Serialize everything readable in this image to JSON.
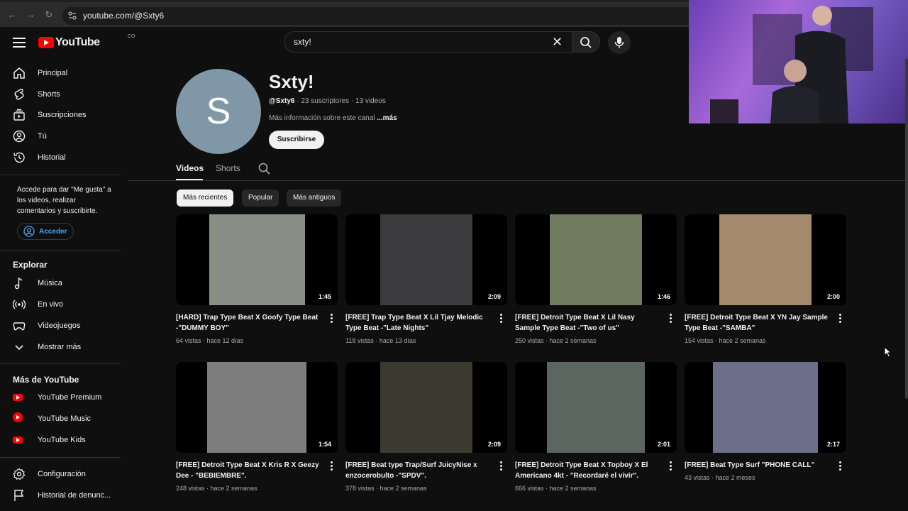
{
  "browser": {
    "url": "youtube.com/@Sxty6"
  },
  "masthead": {
    "logo_text": "YouTube",
    "logo_sup": "CO",
    "search_value": "sxty!"
  },
  "sidebar": {
    "items": [
      {
        "label": "Principal",
        "icon": "home-icon"
      },
      {
        "label": "Shorts",
        "icon": "shorts-icon"
      },
      {
        "label": "Suscripciones",
        "icon": "subscriptions-icon"
      },
      {
        "label": "Tú",
        "icon": "user-icon"
      },
      {
        "label": "Historial",
        "icon": "history-icon"
      }
    ],
    "signin_note": "Accede para dar \"Me gusta\" a los videos, realizar comentarios y suscribirte.",
    "signin_label": "Acceder",
    "explore_heading": "Explorar",
    "explore": [
      {
        "label": "Música",
        "icon": "music-icon"
      },
      {
        "label": "En vivo",
        "icon": "live-icon"
      },
      {
        "label": "Videojuegos",
        "icon": "gaming-icon"
      },
      {
        "label": "Mostrar más",
        "icon": "chevron-down-icon"
      }
    ],
    "more_heading": "Más de YouTube",
    "more": [
      {
        "label": "YouTube Premium",
        "icon": "youtube-premium-icon"
      },
      {
        "label": "YouTube Music",
        "icon": "youtube-music-icon"
      },
      {
        "label": "YouTube Kids",
        "icon": "youtube-kids-icon"
      }
    ],
    "settings": [
      {
        "label": "Configuración",
        "icon": "gear-icon"
      },
      {
        "label": "Historial de denunc...",
        "icon": "flag-icon"
      }
    ]
  },
  "channel": {
    "avatar_letter": "S",
    "name": "Sxty!",
    "handle": "@Sxty6",
    "stats": " · 23 suscriptores · 13 videos",
    "about": "Más información sobre este canal ",
    "about_more": "...más",
    "subscribe_label": "Suscribirse"
  },
  "tabs": {
    "videos": "Videos",
    "shorts": "Shorts"
  },
  "chips": {
    "recent": "Más recientes",
    "popular": "Popular",
    "oldest": "Más antiguos"
  },
  "videos": [
    {
      "title": "[HARD] Trap Type Beat X Goofy Type Beat -\"DUMMY BOY\"",
      "meta": "64 vistas · hace 12 días",
      "duration": "1:45",
      "thumb_color": "#8a8f86"
    },
    {
      "title": "[FREE] Trap Type Beat X Lil Tjay Melodic Type Beat -\"Late Nights\"",
      "meta": "118 vistas · hace 13 días",
      "duration": "2:09",
      "thumb_color": "#3b3b3e"
    },
    {
      "title": "[FREE] Detroit Type Beat X Lil Nasy Sample Type Beat -\"Two of us\"",
      "meta": "250 vistas · hace 2 semanas",
      "duration": "1:46",
      "thumb_color": "#6f7a5e"
    },
    {
      "title": "[FREE] Detroit Type Beat X YN Jay Sample Type Beat -\"SAMBA\"",
      "meta": "154 vistas · hace 2 semanas",
      "duration": "2:00",
      "thumb_color": "#a68a6e"
    },
    {
      "title": "[FREE] Detroit Type Beat X Kris R X Geezy Dee - \"BEBIEMBRE\".",
      "meta": "248 vistas · hace 2 semanas",
      "duration": "1:54",
      "thumb_color": "#7d7d7d"
    },
    {
      "title": "[FREE] Beat type Trap/Surf JuicyNise x enzocerobulto -\"SPDV\".",
      "meta": "378 vistas · hace 2 semanas",
      "duration": "2:09",
      "thumb_color": "#3c3a2e"
    },
    {
      "title": "[FREE] Detroit Type Beat X Topboy X El Americano 4kt - \"Recordaré el vivir\".",
      "meta": "666 vistas · hace 2 semanas",
      "duration": "2:01",
      "thumb_color": "#5a6660"
    },
    {
      "title": "[FREE] Beat Type Surf \"PHONE CALL\"",
      "meta": "43 vistas · hace 2 meses",
      "duration": "2:17",
      "thumb_color": "#6b6f8a"
    }
  ]
}
